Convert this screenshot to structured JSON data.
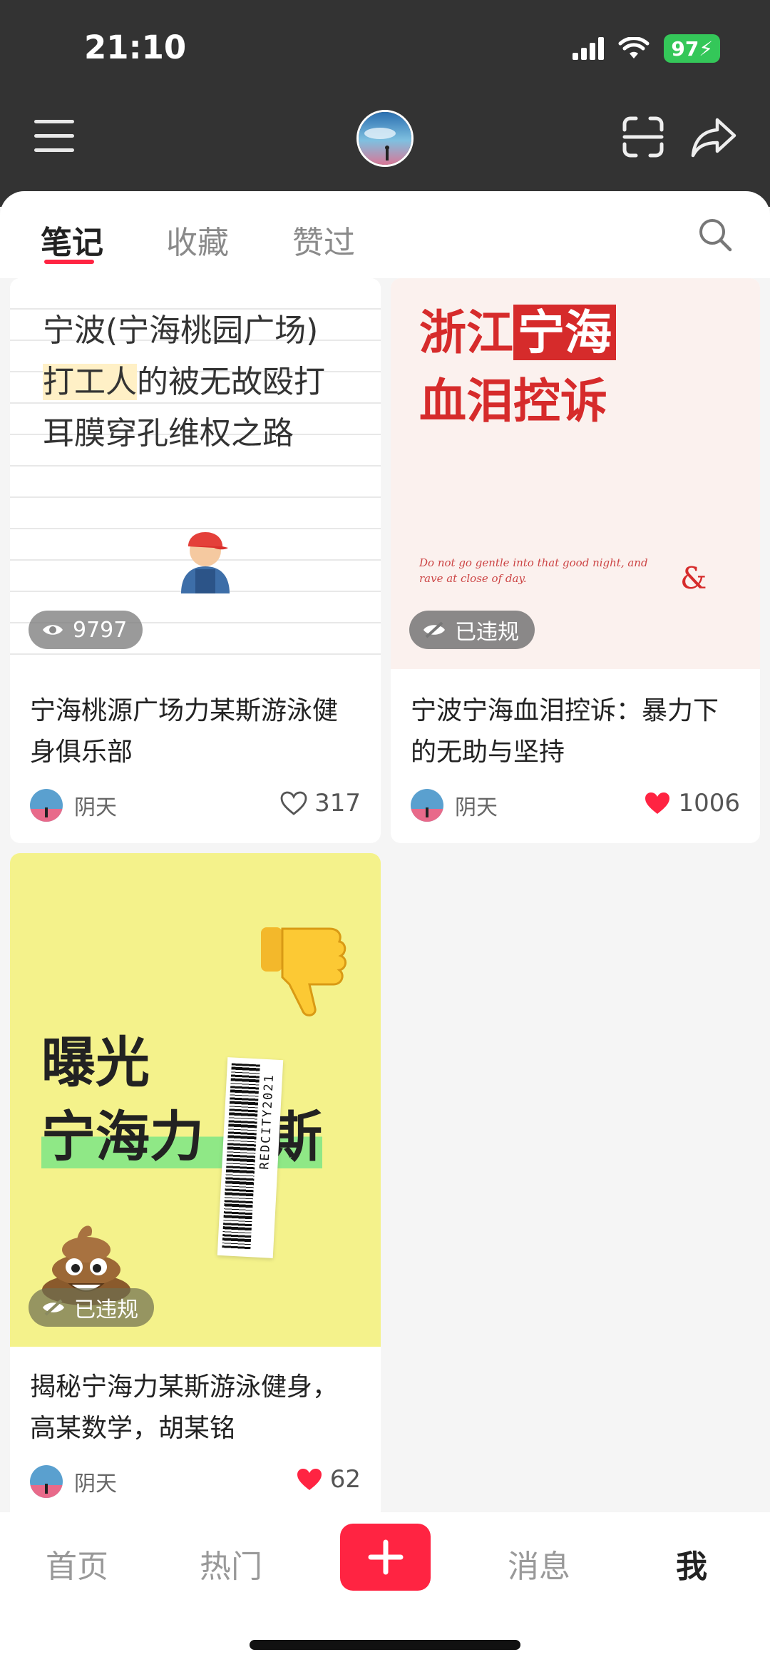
{
  "status_bar": {
    "time": "21:10",
    "battery": "97"
  },
  "tabs": [
    {
      "label": "笔记",
      "active": true
    },
    {
      "label": "收藏",
      "active": false
    },
    {
      "label": "赞过",
      "active": false
    }
  ],
  "notes": [
    {
      "cover_lines": [
        "宁波(宁海桃园广场)",
        "打工人",
        "的被无故殴打",
        "耳膜穿孔维权之路"
      ],
      "badge": "9797",
      "title": "宁海桃源广场力某斯游泳健身俱乐部",
      "author": "阴天",
      "likes": "317",
      "liked": false
    },
    {
      "cover_lines": [
        "浙江",
        "宁海",
        "血泪控诉"
      ],
      "cover_script": "Do not go gentle into that good night, and rave at close of day.",
      "badge": "已违规",
      "title": "宁波宁海血泪控诉：暴力下的无助与坚持",
      "author": "阴天",
      "likes": "1006",
      "liked": true
    },
    {
      "cover_lines": [
        "曝光",
        "宁海力",
        "斯"
      ],
      "barcode_text": "REDCITY2021",
      "badge": "已违规",
      "title": "揭秘宁海力某斯游泳健身，高某数学，胡某铭",
      "author": "阴天",
      "likes": "62",
      "liked": true
    }
  ],
  "bottom_nav": {
    "home": "首页",
    "hot": "热门",
    "messages": "消息",
    "me": "我"
  },
  "colors": {
    "accent": "#ff2442",
    "header_bg": "#333333",
    "battery": "#34c759",
    "card3_bg": "#f4f28b"
  },
  "icons": [
    "menu-icon",
    "scan-icon",
    "share-icon",
    "search-icon",
    "eye-icon",
    "hidden-icon",
    "heart-icon",
    "plus-icon",
    "thumbs-down-icon",
    "poop-icon",
    "worker-icon"
  ]
}
